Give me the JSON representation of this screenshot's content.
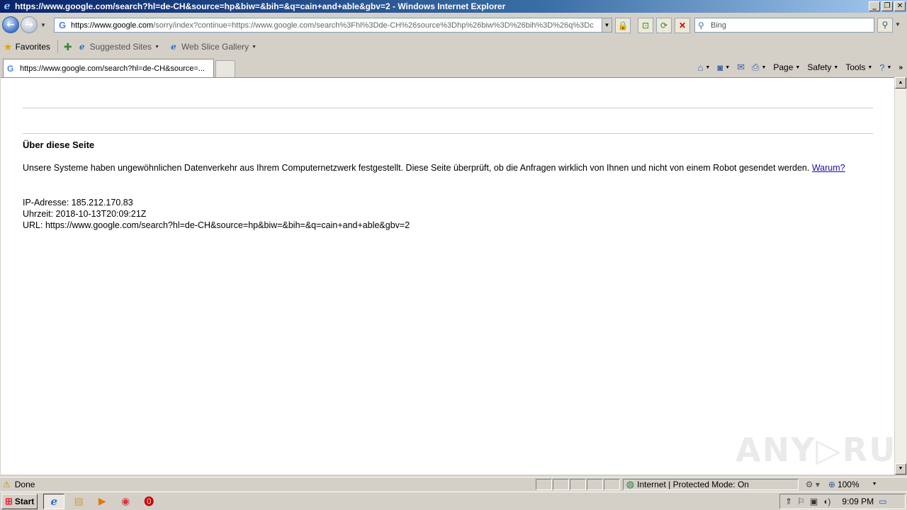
{
  "window": {
    "title": "https://www.google.com/search?hl=de-CH&source=hp&biw=&bih=&q=cain+and+able&gbv=2 - Windows Internet Explorer",
    "minimize": "_",
    "restore": "❐",
    "close": "✕"
  },
  "address_bar": {
    "url_prefix": "https://",
    "url_host": "www.google.com",
    "url_path": "/sorry/index?continue=https://www.google.com/search%3Fhl%3Dde-CH%26source%3Dhp%26biw%3D%26bih%3D%26q%3Dc"
  },
  "search": {
    "placeholder": "Bing"
  },
  "favorites_bar": {
    "favorites_label": "Favorites",
    "items": [
      {
        "label": "Suggested Sites"
      },
      {
        "label": "Web Slice Gallery"
      }
    ]
  },
  "tab": {
    "label": "https://www.google.com/search?hl=de-CH&source=..."
  },
  "command_bar": {
    "page": "Page",
    "safety": "Safety",
    "tools": "Tools"
  },
  "page": {
    "heading": "Über diese Seite",
    "paragraph": "Unsere Systeme haben ungewöhnlichen Datenverkehr aus Ihrem Computernetzwerk festgestellt. Diese Seite überprüft, ob die Anfragen wirklich von Ihnen und nicht von einem Robot gesendet werden.",
    "why_link": "Warum?",
    "ip_line": "IP-Adresse: 185.212.170.83",
    "time_line": "Uhrzeit: 2018-10-13T20:09:21Z",
    "url_line": "URL: https://www.google.com/search?hl=de-CH&source=hp&biw=&bih=&q=cain+and+able&gbv=2",
    "watermark": "ANY▷RUN"
  },
  "status_bar": {
    "status": "Done",
    "zone": "Internet | Protected Mode: On",
    "zoom": "100%"
  },
  "taskbar": {
    "start_label": "Start",
    "clock": "9:09 PM"
  }
}
